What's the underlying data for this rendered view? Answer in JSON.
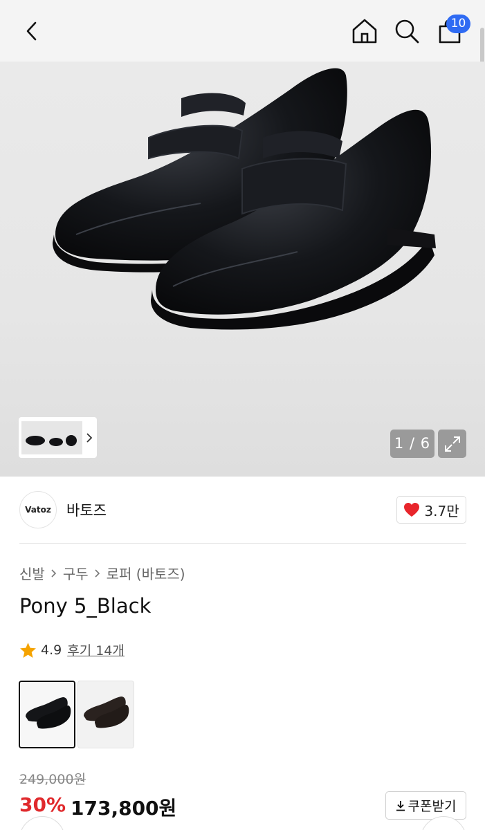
{
  "header": {
    "back_icon": "chevron-left-icon",
    "home_icon": "home-icon",
    "search_icon": "search-icon",
    "cart_icon": "shopping-bag-icon",
    "cart_count": "10",
    "badge_color": "#2f6bf3"
  },
  "gallery": {
    "counter": "1 / 6",
    "expand_icon": "expand-icon"
  },
  "brand": {
    "logo_text": "Vatoz",
    "name": "바토즈",
    "likes": "3.7만",
    "heart_color": "#e8252b"
  },
  "breadcrumb": [
    "신발",
    "구두",
    "로퍼 (바토즈)"
  ],
  "product": {
    "title": "Pony 5_Black",
    "rating": "4.9",
    "reviews_label": "후기 14개",
    "star_color": "#f5a300"
  },
  "price": {
    "original": "249,000원",
    "discount": "30%",
    "sale": "173,800원",
    "discount_color": "#e0292c",
    "coupon_label": "쿠폰받기"
  }
}
